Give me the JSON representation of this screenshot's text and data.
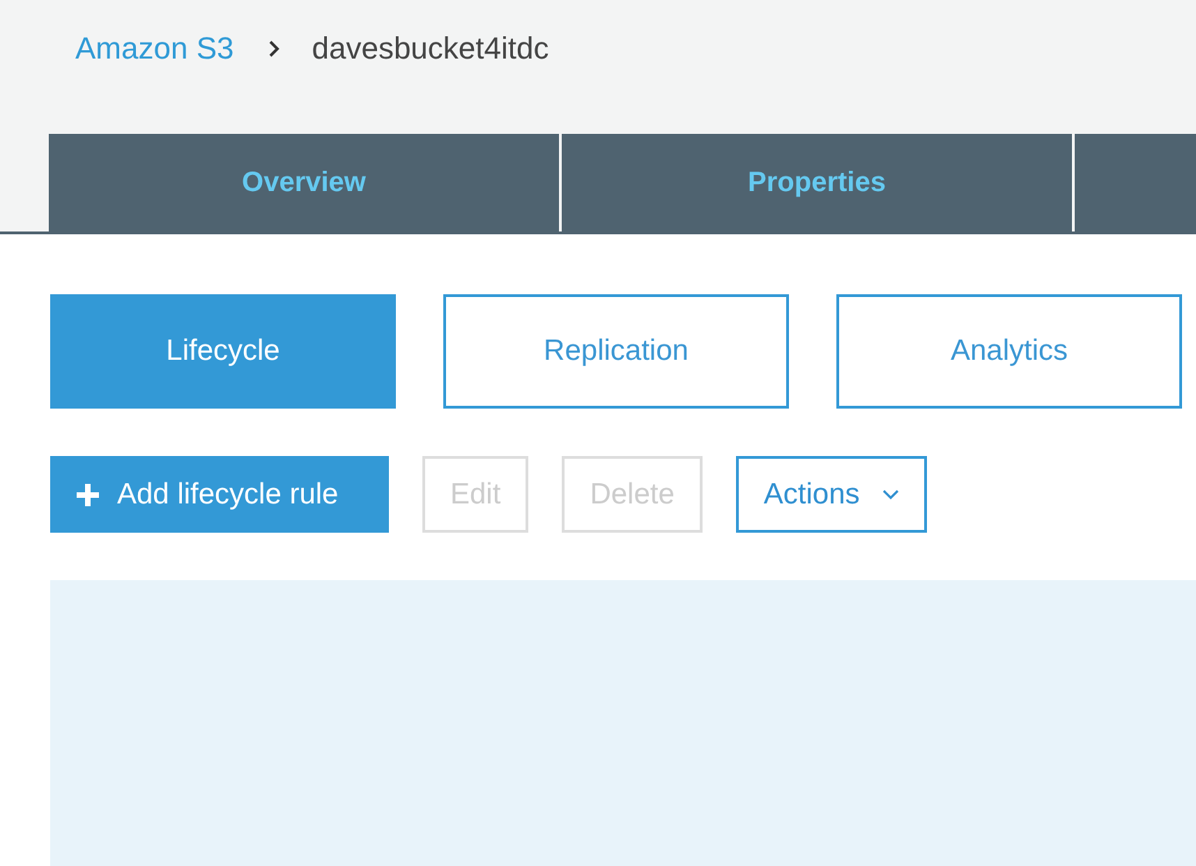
{
  "breadcrumb": [
    {
      "label": "Amazon S3",
      "kind": "link"
    },
    {
      "label": "davesbucket4itdc",
      "kind": "current"
    }
  ],
  "tabs": [
    {
      "label": "Overview"
    },
    {
      "label": "Properties"
    }
  ],
  "subtabs": [
    {
      "label": "Lifecycle",
      "selected": true
    },
    {
      "label": "Replication",
      "selected": false
    },
    {
      "label": "Analytics",
      "selected": false
    }
  ],
  "actions": [
    {
      "label": "Add lifecycle rule",
      "kind": "add",
      "disabled": false
    },
    {
      "label": "Edit",
      "kind": "plain",
      "disabled": true
    },
    {
      "label": "Delete",
      "kind": "plain",
      "disabled": true
    },
    {
      "label": "Actions",
      "kind": "dropdown",
      "disabled": false
    }
  ]
}
